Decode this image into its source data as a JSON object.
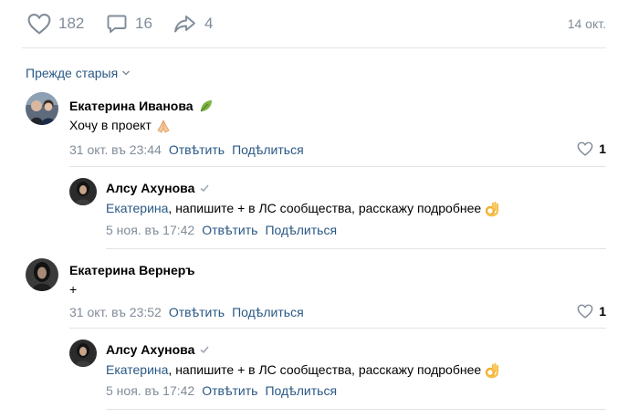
{
  "post_stats": {
    "likes": "182",
    "comments": "16",
    "shares": "4",
    "date": "14 окт."
  },
  "sort": {
    "label": "Прежде старыя"
  },
  "comments": [
    {
      "author": "Екатерина Иванова",
      "text": "Хочу в проект",
      "date": "31 окт. въ 23:44",
      "reply_label": "Отвѣтить",
      "share_label": "Подѣлиться",
      "likes": "1",
      "replies": [
        {
          "author": "Алсу Ахунова",
          "mention": "Екатерина",
          "text": ", напишите + в ЛС сообщества, расскажу подробнее",
          "date": "5 ноя. въ 17:42",
          "reply_label": "Отвѣтить",
          "share_label": "Подѣлиться"
        }
      ]
    },
    {
      "author": "Екатерина Вернеръ",
      "text": "+",
      "date": "31 окт. въ 23:52",
      "reply_label": "Отвѣтить",
      "share_label": "Подѣлиться",
      "likes": "1",
      "replies": [
        {
          "author": "Алсу Ахунова",
          "mention": "Екатерина",
          "text": ", напишите + в ЛС сообщества, расскажу подробнее",
          "date": "5 ноя. въ 17:42",
          "reply_label": "Отвѣтить",
          "share_label": "Подѣлиться"
        }
      ]
    }
  ],
  "colors": {
    "link": "#2a5885",
    "muted": "#818c99",
    "divider": "#e1e3e6"
  }
}
